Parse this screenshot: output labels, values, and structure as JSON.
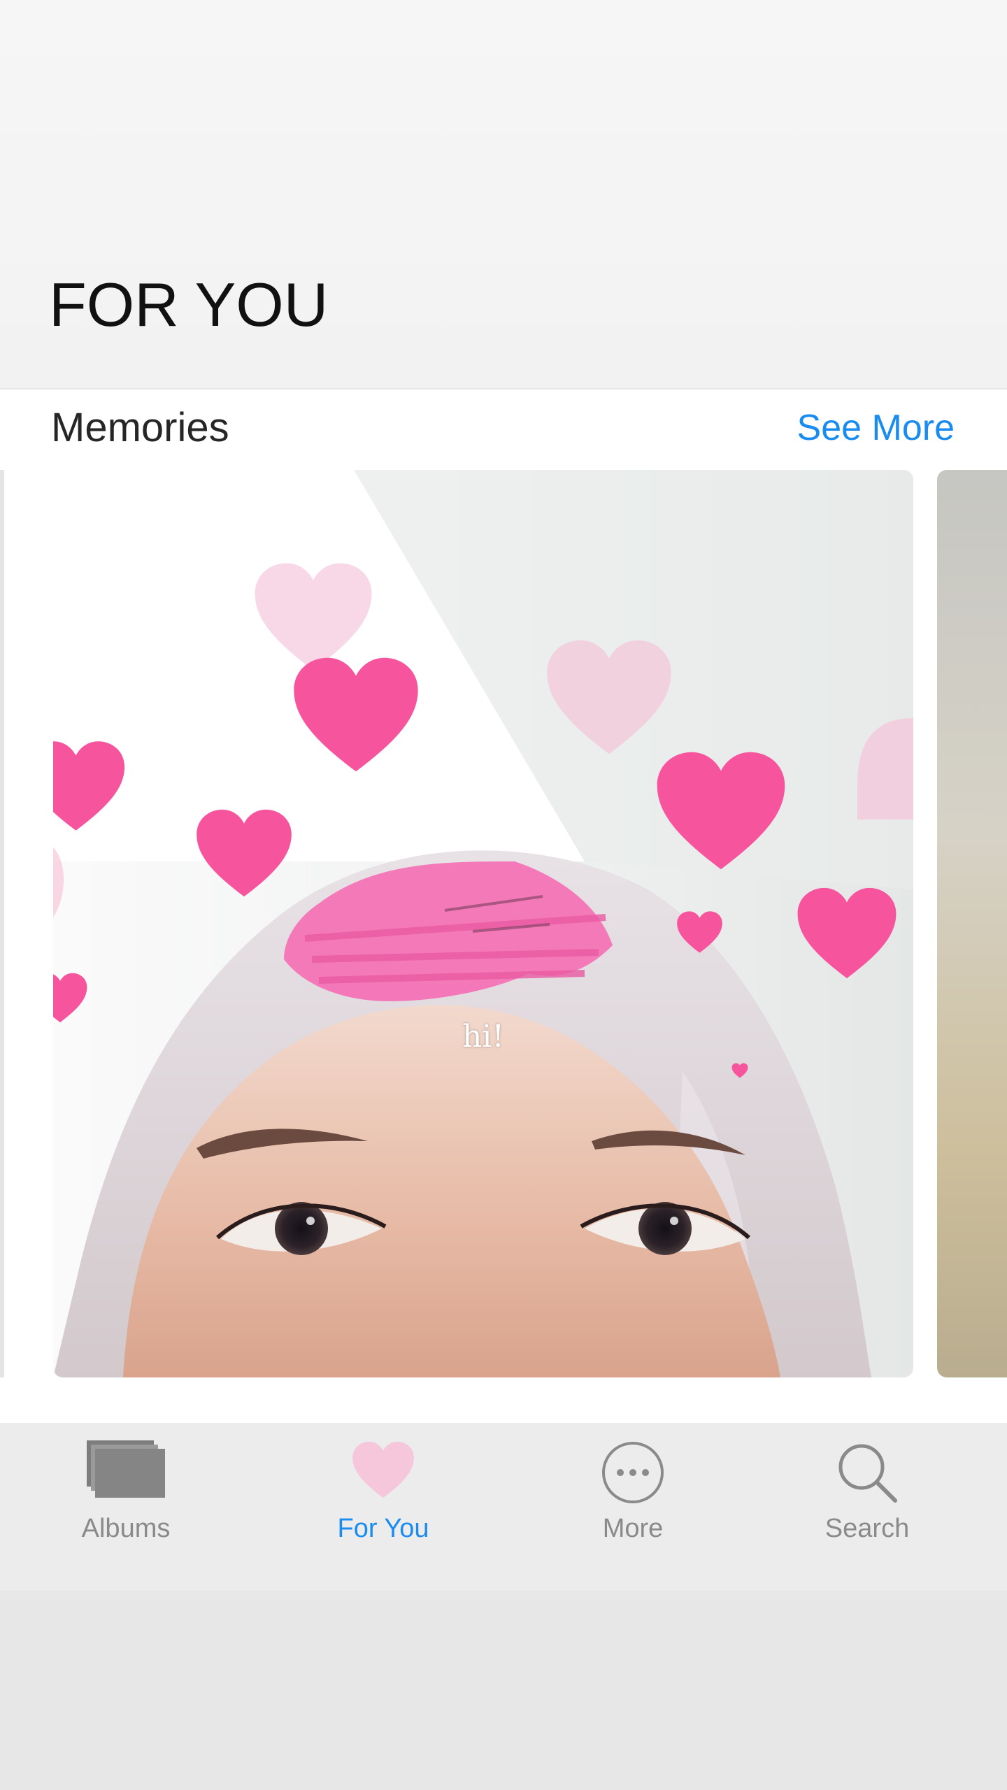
{
  "page": {
    "title": "FOR YOU"
  },
  "memories": {
    "section_title": "Memories",
    "see_more_label": "See More",
    "photo_caption": "hi!"
  },
  "tab_bar": {
    "tabs": [
      {
        "label": "Albums",
        "icon": "albums-icon",
        "active": false
      },
      {
        "label": "For You",
        "icon": "heart-icon",
        "active": true
      },
      {
        "label": "More",
        "icon": "more-icon",
        "active": false
      },
      {
        "label": "Search",
        "icon": "search-icon",
        "active": false
      }
    ]
  },
  "colors": {
    "accent": "#1a8cf0",
    "heart_pink": "#f7549e",
    "heart_light": "#f6c6da",
    "inactive_tab": "#8a8a8a"
  }
}
